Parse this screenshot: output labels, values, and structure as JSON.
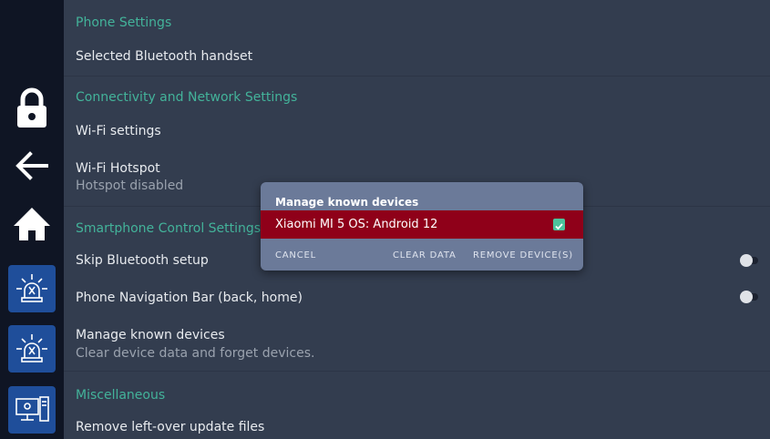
{
  "sidebar": {
    "items": [
      {
        "icon": "lock-icon"
      },
      {
        "icon": "back-arrow-icon"
      },
      {
        "icon": "home-icon"
      },
      {
        "icon": "alarm-siren-icon"
      },
      {
        "icon": "alarm-siren-icon"
      },
      {
        "icon": "computer-icon"
      }
    ]
  },
  "settings": {
    "phone_section": "Phone Settings",
    "selected_handset": "Selected Bluetooth handset",
    "connectivity_section": "Connectivity and Network Settings",
    "wifi_settings": "Wi-Fi settings",
    "wifi_hotspot": "Wi-Fi Hotspot",
    "wifi_hotspot_status": "Hotspot disabled",
    "smartphone_section": "Smartphone Control Settings",
    "skip_bluetooth": "Skip Bluetooth setup",
    "nav_bar": "Phone Navigation Bar (back, home)",
    "manage_devices": "Manage known devices",
    "manage_devices_sub": "Clear device data and forget devices.",
    "misc_section": "Miscellaneous",
    "remove_update_files": "Remove left-over update files"
  },
  "dialog": {
    "title": "Manage known devices",
    "device": "Xiaomi MI 5 OS: Android 12",
    "device_checked": true,
    "cancel": "CANCEL",
    "clear_data": "CLEAR DATA",
    "remove_devices": "REMOVE DEVICE(S)"
  },
  "colors": {
    "section_accent": "#43b39a",
    "selected_row": "#8f0019",
    "sidebar_button": "#1f4e9a"
  }
}
